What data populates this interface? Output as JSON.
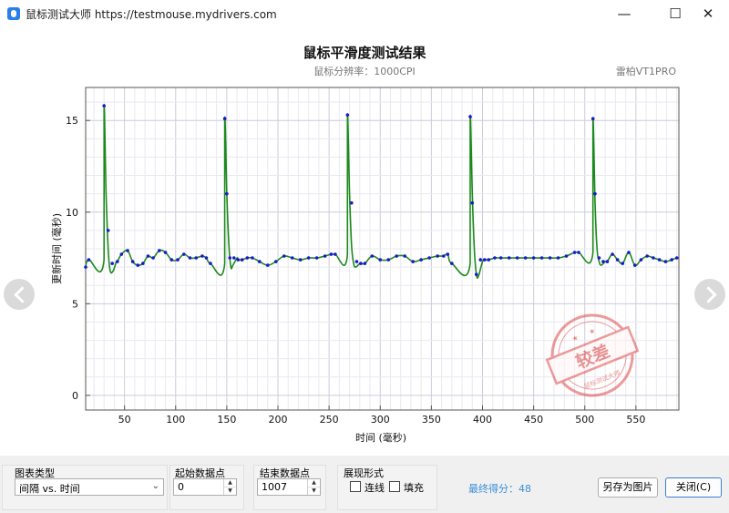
{
  "window": {
    "title": "鼠标测试大师 https://testmouse.mydrivers.com",
    "min_glyph": "—",
    "max_glyph": "☐",
    "close_glyph": "✕"
  },
  "chart_data": {
    "type": "line",
    "title": "鼠标平滑度测试结果",
    "subtitle": "鼠标分辨率：1000CPI",
    "device": "雷柏VT1PRO",
    "xlabel": "时间 (毫秒)",
    "ylabel": "更新时间 (毫秒)",
    "xlim": [
      12,
      592
    ],
    "ylim": [
      -0.8,
      16.8
    ],
    "xticks": [
      50,
      100,
      150,
      200,
      250,
      300,
      350,
      400,
      450,
      500,
      550
    ],
    "yticks": [
      0,
      5,
      10,
      15
    ],
    "grid": true,
    "legend": "none",
    "stamp_text": "较差",
    "stamp_ring_text": "鼠标测试大师",
    "line_color": "#1a8a1a",
    "point_color": "#1a1acc",
    "x": [
      12,
      15,
      30,
      34,
      38,
      43,
      47,
      53,
      58,
      63,
      68,
      73,
      78,
      84,
      90,
      96,
      102,
      108,
      114,
      120,
      126,
      130,
      134,
      148,
      150,
      153,
      157,
      161,
      165,
      170,
      175,
      182,
      190,
      198,
      206,
      214,
      222,
      230,
      238,
      246,
      252,
      256,
      268,
      272,
      277,
      281,
      285,
      292,
      300,
      308,
      316,
      324,
      332,
      340,
      348,
      356,
      362,
      366,
      370,
      388,
      390,
      394,
      398,
      402,
      406,
      412,
      418,
      426,
      434,
      442,
      450,
      458,
      466,
      474,
      482,
      490,
      494,
      508,
      510,
      514,
      518,
      522,
      527,
      532,
      537,
      543,
      549,
      555,
      561,
      567,
      573,
      579,
      585,
      590
    ],
    "y": [
      7.0,
      7.4,
      15.8,
      9.0,
      7.2,
      7.3,
      7.7,
      7.9,
      7.3,
      7.1,
      7.2,
      7.6,
      7.5,
      7.9,
      7.8,
      7.4,
      7.4,
      7.7,
      7.5,
      7.5,
      7.6,
      7.5,
      7.2,
      15.1,
      11.0,
      7.5,
      7.5,
      7.4,
      7.4,
      7.5,
      7.5,
      7.3,
      7.1,
      7.3,
      7.6,
      7.5,
      7.4,
      7.5,
      7.5,
      7.6,
      7.7,
      7.7,
      15.3,
      10.5,
      7.3,
      7.2,
      7.2,
      7.6,
      7.4,
      7.4,
      7.6,
      7.6,
      7.3,
      7.4,
      7.5,
      7.6,
      7.6,
      7.7,
      7.2,
      15.2,
      10.5,
      6.6,
      7.4,
      7.4,
      7.4,
      7.5,
      7.5,
      7.5,
      7.5,
      7.5,
      7.5,
      7.5,
      7.5,
      7.5,
      7.6,
      7.8,
      7.8,
      15.1,
      11.0,
      7.5,
      7.3,
      7.3,
      7.7,
      7.4,
      7.2,
      7.8,
      7.1,
      7.4,
      7.6,
      7.5,
      7.4,
      7.3,
      7.4,
      7.5
    ],
    "spikes": [
      {
        "t": [
          30,
          32,
          34,
          36,
          39,
          42
        ],
        "v": [
          15.8,
          11.0,
          8.0,
          6.8,
          6.8,
          7.3
        ]
      },
      {
        "t": [
          148,
          150,
          152,
          154,
          156,
          160
        ],
        "v": [
          15.1,
          11.0,
          8.3,
          7.0,
          7.1,
          7.5
        ]
      },
      {
        "t": [
          268,
          270,
          272,
          274,
          276,
          280
        ],
        "v": [
          15.3,
          11.0,
          8.2,
          7.2,
          7.0,
          7.2
        ]
      },
      {
        "t": [
          388,
          390,
          392,
          394,
          396,
          400
        ],
        "v": [
          15.2,
          11.0,
          8.0,
          6.6,
          6.5,
          7.3
        ]
      },
      {
        "t": [
          508,
          510,
          512,
          514,
          516,
          520
        ],
        "v": [
          15.1,
          10.5,
          8.0,
          7.3,
          7.1,
          7.3
        ]
      }
    ]
  },
  "panel": {
    "chart_type_label": "图表类型",
    "chart_type_value": "间隔 vs. 时间",
    "start_label": "起始数据点",
    "start_value": "0",
    "end_label": "结束数据点",
    "end_value": "1007",
    "display_label": "展现形式",
    "connect_label": "连线",
    "fill_label": "填充",
    "score_text": "最终得分：48",
    "save_label": "另存为图片",
    "close_label": "关闭(C)"
  }
}
